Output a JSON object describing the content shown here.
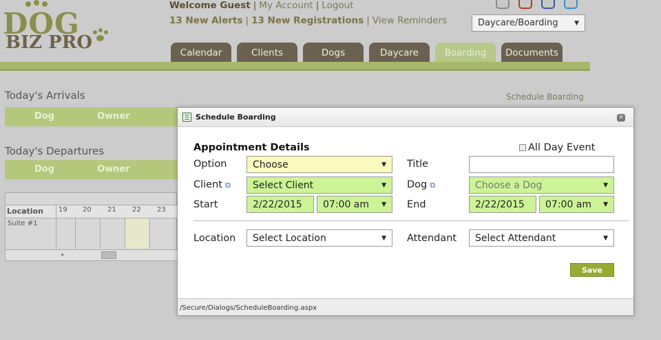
{
  "header": {
    "logo_top": "DOG",
    "logo_bottom": "BIZ PRO",
    "welcome": "Welcome Guest",
    "my_account": "My Account",
    "logout": "Logout",
    "alerts": "13 New Alerts",
    "registrations": "13 New Registrations",
    "reminders": "View Reminders",
    "business_select": "Daycare/Boarding",
    "social_icons": [
      "headphones-icon",
      "youtube-icon",
      "facebook-icon",
      "twitter-icon"
    ]
  },
  "tabs": [
    {
      "label": "Calendar"
    },
    {
      "label": "Clients"
    },
    {
      "label": "Dogs"
    },
    {
      "label": "Daycare"
    },
    {
      "label": "Boarding",
      "active": true
    },
    {
      "label": "Documents"
    }
  ],
  "page": {
    "arrivals_title": "Today's Arrivals",
    "departures_title": "Today's Departures",
    "col_dog": "Dog",
    "col_owner": "Owner",
    "schedule_link": "Schedule Boarding",
    "calendar": {
      "location_header": "Location",
      "days": [
        "19",
        "20",
        "21",
        "22",
        "23"
      ],
      "row": "Suite #1"
    }
  },
  "dialog": {
    "title": "Schedule Boarding",
    "heading": "Appointment Details",
    "all_day": "All Day Event",
    "option_label": "Option",
    "option_value": "Choose",
    "title_label": "Title",
    "title_value": "",
    "client_label": "Client",
    "client_value": "Select Client",
    "dog_label": "Dog",
    "dog_value": "Choose a Dog",
    "start_label": "Start",
    "start_date": "2/22/2015",
    "start_time": "07:00 am",
    "end_label": "End",
    "end_date": "2/22/2015",
    "end_time": "07:00 am",
    "location_label": "Location",
    "location_value": "Select Location",
    "attendant_label": "Attendant",
    "attendant_value": "Select Attendant",
    "save_label": "Save",
    "footer_path": "/Secure/Dialogs/ScheduleBoarding.aspx"
  },
  "colors": {
    "brand_olive": "#8a8f4c",
    "tab_brown": "#6a6151",
    "accent_green": "#b4c87c",
    "save_green": "#98ab33",
    "field_green": "#ccf496",
    "field_yellow": "#fbfbc0"
  }
}
